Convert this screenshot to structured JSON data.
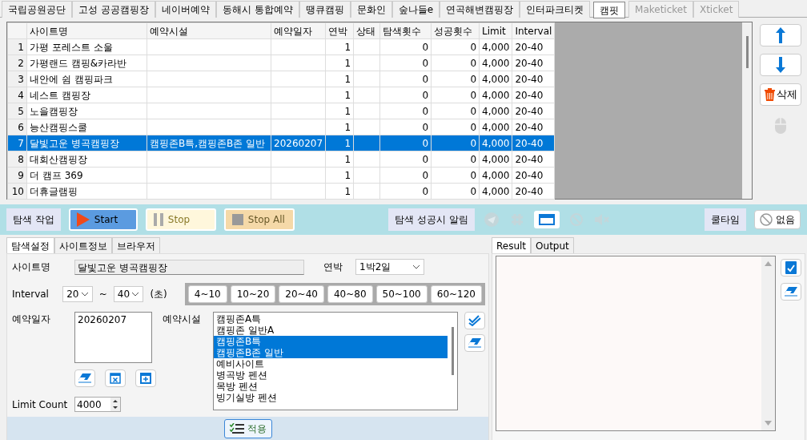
{
  "site_tabs": [
    {
      "label": "국립공원공단",
      "selected": false,
      "disabled": false
    },
    {
      "label": "고성 공공캠핑장",
      "selected": false,
      "disabled": false
    },
    {
      "label": "네이버예약",
      "selected": false,
      "disabled": false
    },
    {
      "label": "동해시 통합예약",
      "selected": false,
      "disabled": false
    },
    {
      "label": "땡큐캠핑",
      "selected": false,
      "disabled": false
    },
    {
      "label": "문화인",
      "selected": false,
      "disabled": false
    },
    {
      "label": "숲나들e",
      "selected": false,
      "disabled": false
    },
    {
      "label": "연곡해변캠핑장",
      "selected": false,
      "disabled": false
    },
    {
      "label": "인터파크티켓",
      "selected": false,
      "disabled": false
    },
    {
      "label": "캠핏",
      "selected": true,
      "disabled": false
    },
    {
      "label": "Maketicket",
      "selected": false,
      "disabled": true
    },
    {
      "label": "Xticket",
      "selected": false,
      "disabled": true
    }
  ],
  "table": {
    "columns": [
      "사이트명",
      "예약시설",
      "예약일자",
      "연박",
      "상태",
      "탐색횟수",
      "성공횟수",
      "Limit",
      "Interval"
    ],
    "rows": [
      {
        "index": "1",
        "selected": false,
        "cells": [
          "가평 포레스트 소울",
          "",
          "",
          "1",
          "",
          "0",
          "0",
          "4,000",
          "20-40"
        ]
      },
      {
        "index": "2",
        "selected": false,
        "cells": [
          "가평랜드 캠핑&카라반",
          "",
          "",
          "1",
          "",
          "0",
          "0",
          "4,000",
          "20-40"
        ]
      },
      {
        "index": "3",
        "selected": false,
        "cells": [
          "내안에 쉼 캠핑파크",
          "",
          "",
          "1",
          "",
          "0",
          "0",
          "4,000",
          "20-40"
        ]
      },
      {
        "index": "4",
        "selected": false,
        "cells": [
          "네스트 캠핑장",
          "",
          "",
          "1",
          "",
          "0",
          "0",
          "4,000",
          "20-40"
        ]
      },
      {
        "index": "5",
        "selected": false,
        "cells": [
          "노을캠핑장",
          "",
          "",
          "1",
          "",
          "0",
          "0",
          "4,000",
          "20-40"
        ]
      },
      {
        "index": "6",
        "selected": false,
        "cells": [
          "능산캠핑스쿨",
          "",
          "",
          "1",
          "",
          "0",
          "0",
          "4,000",
          "20-40"
        ]
      },
      {
        "index": "7",
        "selected": true,
        "cells": [
          "달빛고운 병곡캠핑장",
          "캠핑존B특,캠핑존B존 일반",
          "20260207",
          "1",
          "",
          "0",
          "0",
          "4,000",
          "20-40"
        ]
      },
      {
        "index": "8",
        "selected": false,
        "cells": [
          "대회산캠핑장",
          "",
          "",
          "1",
          "",
          "0",
          "0",
          "4,000",
          "20-40"
        ]
      },
      {
        "index": "9",
        "selected": false,
        "cells": [
          "더 캠프 369",
          "",
          "",
          "1",
          "",
          "0",
          "0",
          "4,000",
          "20-40"
        ]
      },
      {
        "index": "10",
        "selected": false,
        "cells": [
          "더휴글램핑",
          "",
          "",
          "1",
          "",
          "0",
          "0",
          "4,000",
          "20-40"
        ]
      }
    ]
  },
  "side_buttons": [
    {
      "kind": "up"
    },
    {
      "kind": "down"
    },
    {
      "kind": "delete",
      "label": "삭제"
    },
    {
      "kind": "mouse"
    }
  ],
  "toolbar": {
    "task_label": "탐색 작업",
    "buttons": [
      {
        "kind": "start",
        "label": "Start"
      },
      {
        "kind": "stop",
        "label": "Stop"
      },
      {
        "kind": "stopall",
        "label": "Stop All"
      }
    ],
    "alert_label": "탐색 성공시 알림",
    "alert_icons": [
      {
        "kind": "send",
        "disabled": true
      },
      {
        "kind": "hash",
        "disabled": true
      },
      {
        "kind": "window",
        "disabled": false
      },
      {
        "kind": "block",
        "disabled": true
      },
      {
        "kind": "mute",
        "disabled": true
      }
    ],
    "cooltime_label": "쿨타임",
    "cooltime_button": "없음"
  },
  "settings": {
    "tabs": [
      {
        "label": "탐색설정",
        "selected": true
      },
      {
        "label": "사이트정보",
        "selected": false
      },
      {
        "label": "브라우저",
        "selected": false
      }
    ],
    "site_label": "사이트명",
    "site_value": "달빛고운 병곡캠핑장",
    "nights_label": "연박",
    "nights_value": "1박2일",
    "interval_label": "Interval",
    "interval_from": "20",
    "tilde": "~",
    "interval_to": "40",
    "unit": "(초)",
    "presets": [
      "4~10",
      "10~20",
      "20~40",
      "40~80",
      "50~100",
      "60~120"
    ],
    "date_label": "예약일자",
    "dates": "20260207",
    "facility_label": "예약시설",
    "facilities": [
      {
        "label": "캠핑존A특",
        "selected": false
      },
      {
        "label": "캠핑존 일반A",
        "selected": false
      },
      {
        "label": "캠핑존B특",
        "selected": true
      },
      {
        "label": "캠핑존B존 일반",
        "selected": true
      },
      {
        "label": "예비사이트",
        "selected": false
      },
      {
        "label": "병곡방 펜션",
        "selected": false
      },
      {
        "label": "목방 펜션",
        "selected": false
      },
      {
        "label": "빙기실방 펜션",
        "selected": false
      }
    ],
    "limit_label": "Limit Count",
    "limit_value": "4000",
    "apply_label": "적용"
  },
  "output": {
    "tabs": [
      {
        "label": "Result",
        "selected": true
      },
      {
        "label": "Output",
        "selected": false
      }
    ]
  }
}
